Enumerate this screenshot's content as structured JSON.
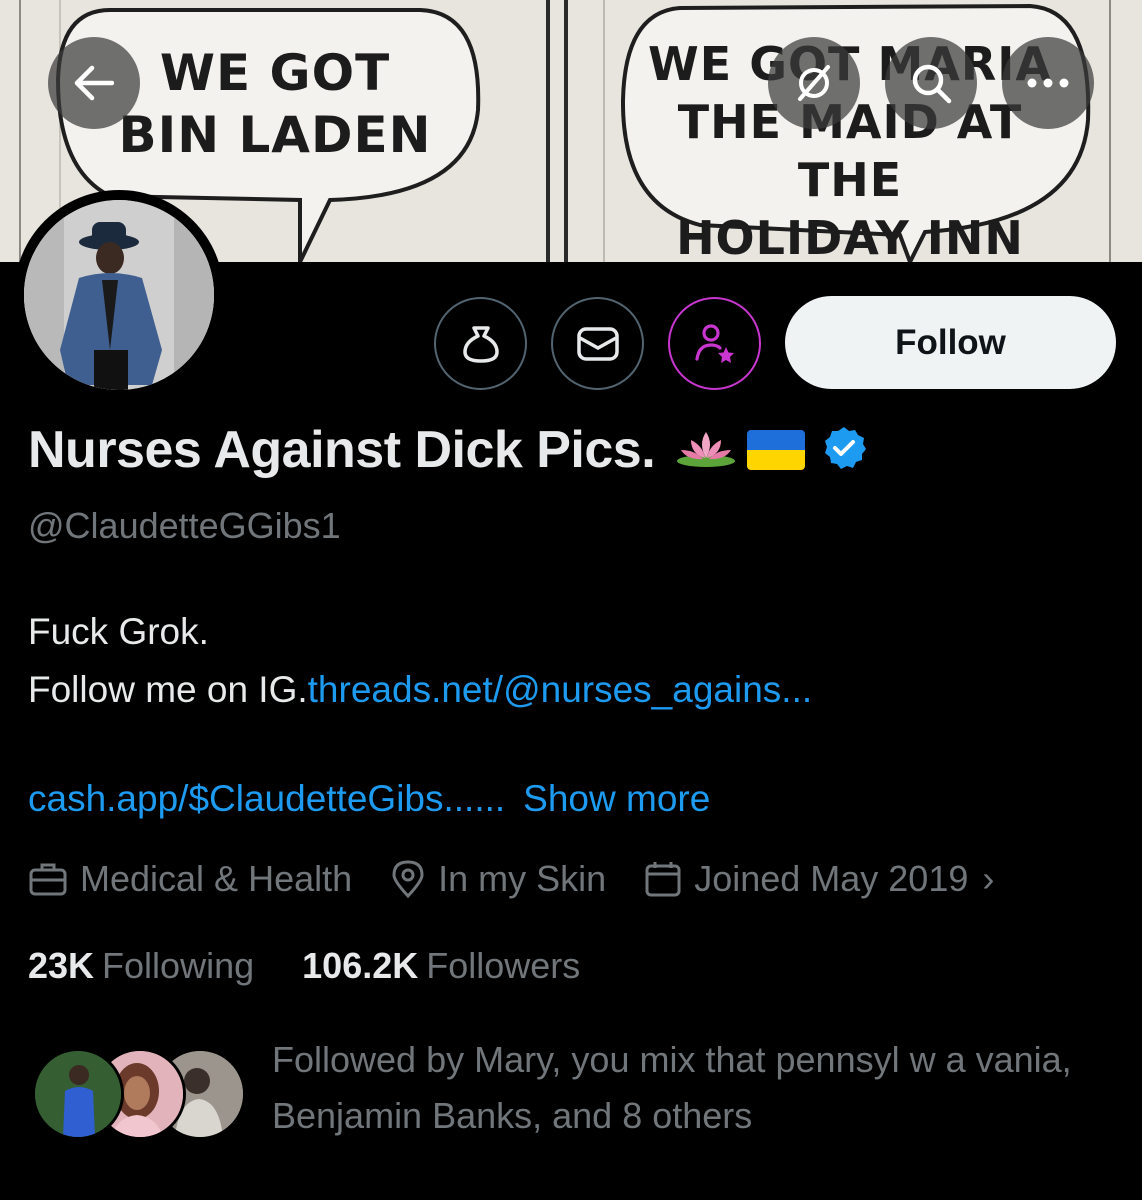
{
  "banner": {
    "left_bubble_lines": [
      "WE GOT",
      "BIN LADEN"
    ],
    "right_bubble_lines": [
      "WE GOT MARIA",
      "THE MAID AT THE",
      "HOLIDAY INN"
    ]
  },
  "top_bar": {
    "back_icon": "arrow-left-icon",
    "grok_icon": "grok-slash-icon",
    "search_icon": "search-icon",
    "more_icon": "more-dots-icon",
    "more_label": "..."
  },
  "actions": {
    "tip_icon": "money-bag-icon",
    "message_icon": "envelope-icon",
    "subscribe_icon": "person-star-icon",
    "follow_label": "Follow"
  },
  "profile": {
    "display_name": "Nurses Against Dick Pics.",
    "emoji": [
      "lotus-emoji",
      "ukraine-flag-emoji"
    ],
    "verified_icon": "verified-badge-icon",
    "handle": "@ClaudetteGGibs1",
    "bio_line1": "Fuck Grok.",
    "bio_line2_text": "Follow me on IG.",
    "bio_line2_link": "threads.net/@nurses_agains...",
    "bio_line3_link": "cash.app/$ClaudetteGibs......",
    "show_more": "Show more",
    "category": "Medical & Health",
    "location": "In my Skin",
    "joined": "Joined May 2019",
    "joined_chevron": "›"
  },
  "stats": {
    "following_count": "23K",
    "following_label": "Following",
    "followers_count": "106.2K",
    "followers_label": "Followers"
  },
  "followed_by": {
    "text": "Followed by Mary, you mix that pennsyl w a vania, Benjamin Banks, and 8 others"
  },
  "colors": {
    "background": "#000000",
    "link": "#1d9bf0",
    "muted": "#71767b",
    "text": "#e7e9ea",
    "subscribe_border": "#c936cf",
    "verified": "#1d9bf0"
  }
}
